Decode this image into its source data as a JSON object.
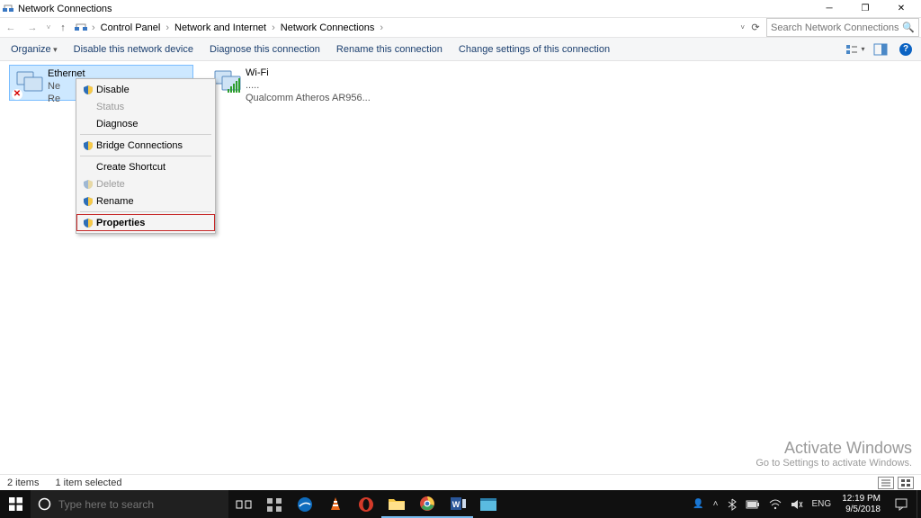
{
  "window": {
    "title": "Network Connections"
  },
  "breadcrumbs": {
    "seg1": "Control Panel",
    "seg2": "Network and Internet",
    "seg3": "Network Connections"
  },
  "search": {
    "placeholder": "Search Network Connections"
  },
  "commands": {
    "organize": "Organize",
    "disable": "Disable this network device",
    "diagnose": "Diagnose this connection",
    "rename": "Rename this connection",
    "change": "Change settings of this connection"
  },
  "connections": {
    "ethernet": {
      "name": "Ethernet",
      "line2": "Ne",
      "line3": "Re"
    },
    "wifi": {
      "name": "Wi-Fi",
      "line2": ".....",
      "line3": "Qualcomm Atheros AR956..."
    }
  },
  "context_menu": {
    "disable": "Disable",
    "status": "Status",
    "diagnose": "Diagnose",
    "bridge": "Bridge Connections",
    "shortcut": "Create Shortcut",
    "delete": "Delete",
    "rename": "Rename",
    "properties": "Properties"
  },
  "statusbar": {
    "count": "2 items",
    "selected": "1 item selected"
  },
  "watermark": {
    "title": "Activate Windows",
    "sub": "Go to Settings to activate Windows."
  },
  "taskbar": {
    "search_placeholder": "Type here to search",
    "lang": "ENG",
    "time": "12:19 PM",
    "date": "9/5/2018"
  }
}
